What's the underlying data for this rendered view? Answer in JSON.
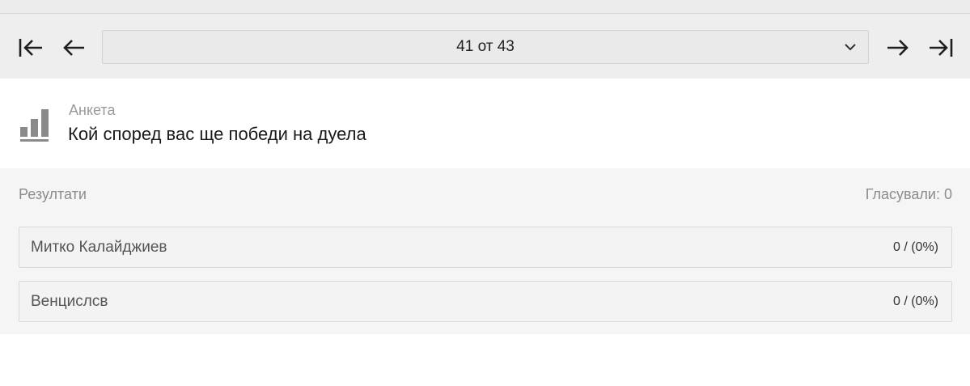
{
  "navigation": {
    "first_icon": "first-page-icon",
    "prev_icon": "arrow-left-icon",
    "next_icon": "arrow-right-icon",
    "last_icon": "last-page-icon",
    "page_label": "41 от 43",
    "dropdown_icon": "chevron-down-icon",
    "current_page": 41,
    "total_pages": 43
  },
  "poll": {
    "icon": "bar-chart-icon",
    "type_label": "Анкета",
    "question": "Кой според вас ще победи на дуела"
  },
  "results": {
    "title": "Резултати",
    "voted_label": "Гласували: 0",
    "options": [
      {
        "name": "Митко Калайджиев",
        "value": "0 / (0%)"
      },
      {
        "name": "Венцислсв",
        "value": "0 / (0%)"
      }
    ]
  },
  "colors": {
    "nav_bar_bg": "#eeeeee",
    "results_bg": "#f5f5f5",
    "icon_gray": "#8a8a8a",
    "text_dark": "#1a1a1a",
    "text_muted": "#8c8c8c"
  }
}
